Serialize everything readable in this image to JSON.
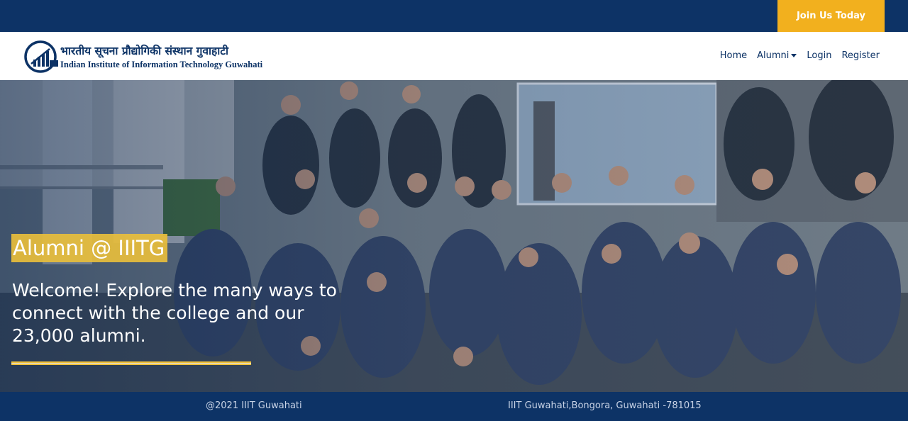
{
  "topbar": {
    "join_label": "Join Us Today",
    "bg_color": "#0d3366",
    "join_color": "#f2b01e"
  },
  "logo": {
    "name_hindi": "भारतीय सूचना प्रौद्योगिकी संस्थान गुवाहाटी",
    "name_english": "Indian Institute of Information Technology Guwahati",
    "icon": "bar-chart-logo-icon"
  },
  "nav": {
    "items": [
      {
        "label": "Home"
      },
      {
        "label": "Alumni",
        "has_dropdown": true
      },
      {
        "label": "Login"
      },
      {
        "label": "Register"
      }
    ]
  },
  "hero": {
    "title": "Alumni @ IIITG",
    "subtitle": "Welcome! Explore the many ways to connect with the college and our 23,000 alumni."
  },
  "footer": {
    "copyright": "@2021 IIIT Guwahati",
    "address": "IIIT Guwahati,Bongora, Guwahati -781015"
  }
}
